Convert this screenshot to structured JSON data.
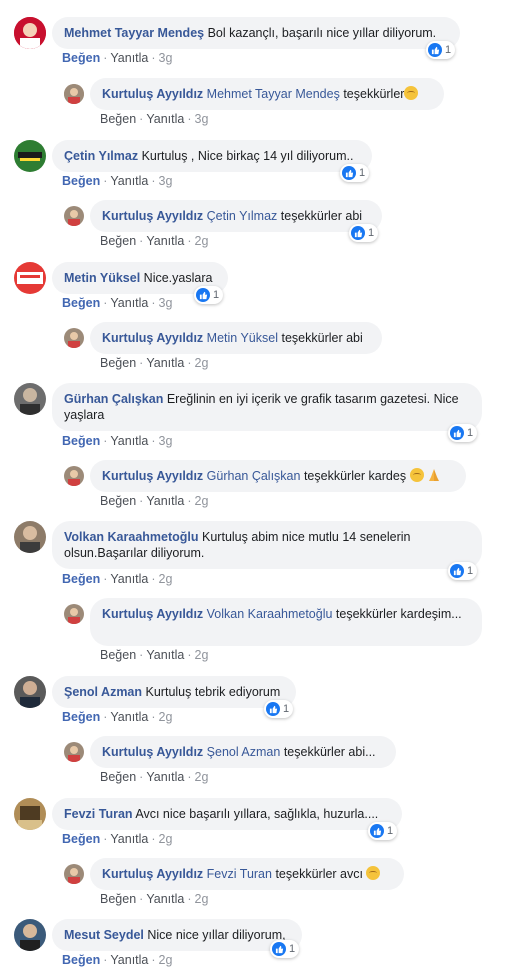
{
  "labels": {
    "like": "Beğen",
    "reply": "Yanıtla"
  },
  "comments": [
    {
      "name": "Mehmet Tayyar Mendeş",
      "text": "Bol kazançlı, başarılı nice yıllar diliyorum.",
      "time": "3g",
      "reactions": "1",
      "reply": {
        "name": "Kurtuluş Ayyıldız",
        "tag": "Mehmet Tayyar Mendeş",
        "text": "teşekkürler",
        "time": "3g"
      }
    },
    {
      "name": "Çetin Yılmaz",
      "text": "Kurtuluş , Nice birkaç 14 yıl diliyorum..",
      "time": "3g",
      "reactions": "1",
      "reply": {
        "name": "Kurtuluş Ayyıldız",
        "tag": "Çetin Yılmaz",
        "text": "teşekkürler abi",
        "time": "2g",
        "reactions": "1"
      }
    },
    {
      "name": "Metin Yüksel",
      "text": "Nice.yaslara",
      "time": "3g",
      "reactions": "1",
      "reply": {
        "name": "Kurtuluş Ayyıldız",
        "tag": "Metin Yüksel",
        "text": "teşekkürler abi",
        "time": "2g"
      }
    },
    {
      "name": "Gürhan Çalışkan",
      "text": "Ereğlinin en iyi içerik ve grafik tasarım gazetesi. Nice yaşlara",
      "time": "3g",
      "reactions": "1",
      "reply": {
        "name": "Kurtuluş Ayyıldız",
        "tag": "Gürhan Çalışkan",
        "text": "teşekkürler kardeş",
        "time": "2g"
      }
    },
    {
      "name": "Volkan Karaahmetoğlu",
      "text": "Kurtuluş abim nice mutlu 14 senelerin olsun.Başarılar diliyorum.",
      "time": "2g",
      "reactions": "1",
      "reply": {
        "name": "Kurtuluş Ayyıldız",
        "tag": "Volkan Karaahmetoğlu",
        "text": "teşekkürler kardeşim...",
        "time": "2g"
      }
    },
    {
      "name": "Şenol Azman",
      "text": "Kurtuluş tebrik ediyorum",
      "time": "2g",
      "reactions": "1",
      "reply": {
        "name": "Kurtuluş Ayyıldız",
        "tag": "Şenol Azman",
        "text": "teşekkürler abi...",
        "time": "2g"
      }
    },
    {
      "name": "Fevzi Turan",
      "text": "Avcı nice başarılı yıllara, sağlıkla, huzurla....",
      "time": "2g",
      "reactions": "1",
      "reply": {
        "name": "Kurtuluş Ayyıldız",
        "tag": "Fevzi Turan",
        "text": "teşekkürler avcı",
        "time": "2g"
      }
    },
    {
      "name": "Mesut Seydel",
      "text": "Nice nice yıllar diliyorum,",
      "time": "2g",
      "reactions": "1"
    }
  ],
  "colors": {
    "link": "#385898",
    "like": "#4267b2",
    "bubble": "#f2f3f5",
    "reaction": "#1877f2"
  }
}
